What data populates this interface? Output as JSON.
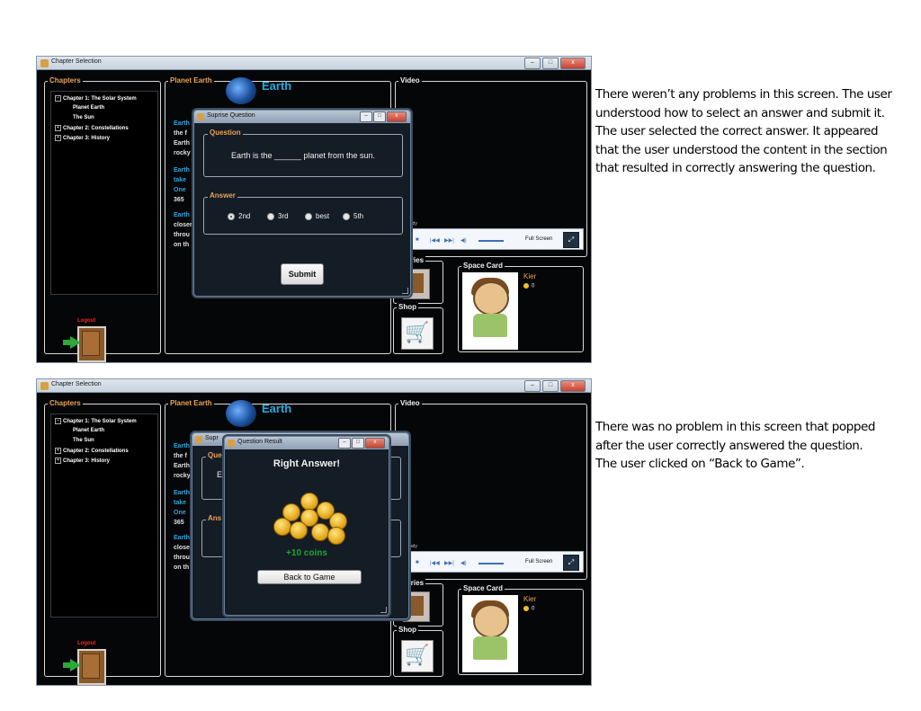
{
  "window_title": "Chapter Selection",
  "titlebar_buttons": [
    "–",
    "□",
    "x"
  ],
  "panels": {
    "chapters": "Chapters",
    "planet_earth": "Planet Earth",
    "video": "Video",
    "accessories": "ssories",
    "shop": "Shop",
    "space_card": "Space Card"
  },
  "chapters": {
    "items": [
      {
        "expander": "–",
        "label": "Chapter 1: The Solar System"
      },
      {
        "expander": "",
        "label": "Planet Earth"
      },
      {
        "expander": "",
        "label": "The Sun"
      },
      {
        "expander": "+",
        "label": "Chapter 2: Constellations"
      },
      {
        "expander": "+",
        "label": "Chapter 3: History"
      }
    ],
    "logout": "Logout"
  },
  "earth": {
    "title": "Earth",
    "body_lines_1": [
      "Earth",
      "the f",
      "Earth",
      "rocky"
    ],
    "body_lines_2": [
      "Earth",
      "take",
      "One",
      "365"
    ],
    "body_lines_3": [
      "Earth",
      "closer",
      "throu",
      "on th"
    ]
  },
  "player": {
    "status": "eady",
    "full_screen": "Full Screen",
    "controls": [
      "■",
      "|◀◀",
      "▶▶|",
      "◀)"
    ]
  },
  "space_card": {
    "name": "Kier",
    "coins": "0"
  },
  "question_dialog": {
    "title": "Suprise Question",
    "question_label": "Question",
    "question_text": "Earth is the ______ planet from the sun.",
    "answer_label": "Answer",
    "options": [
      "2nd",
      "3rd",
      "best",
      "5th"
    ],
    "selected": "2nd",
    "submit": "Submit"
  },
  "result_dialog": {
    "title": "Question Result",
    "headline": "Right Answer!",
    "reward": "+10 coins",
    "back_button": "Back to Game"
  },
  "partial_under_result": {
    "title": "Supr",
    "q": "Que",
    "e": "E",
    "a": "Ans"
  },
  "notes": {
    "top": [
      "There weren’t any problems in this screen.  The user",
      " understood how to select an answer and submit it.",
      " The user selected the correct answer. It appeared",
      "that the user understood the content in the section",
      "that resulted in correctly answering the question."
    ],
    "bottom": [
      "There was no problem in this screen that popped",
      "after the user correctly answered the question.",
      "The user clicked on “Back to Game”."
    ]
  }
}
